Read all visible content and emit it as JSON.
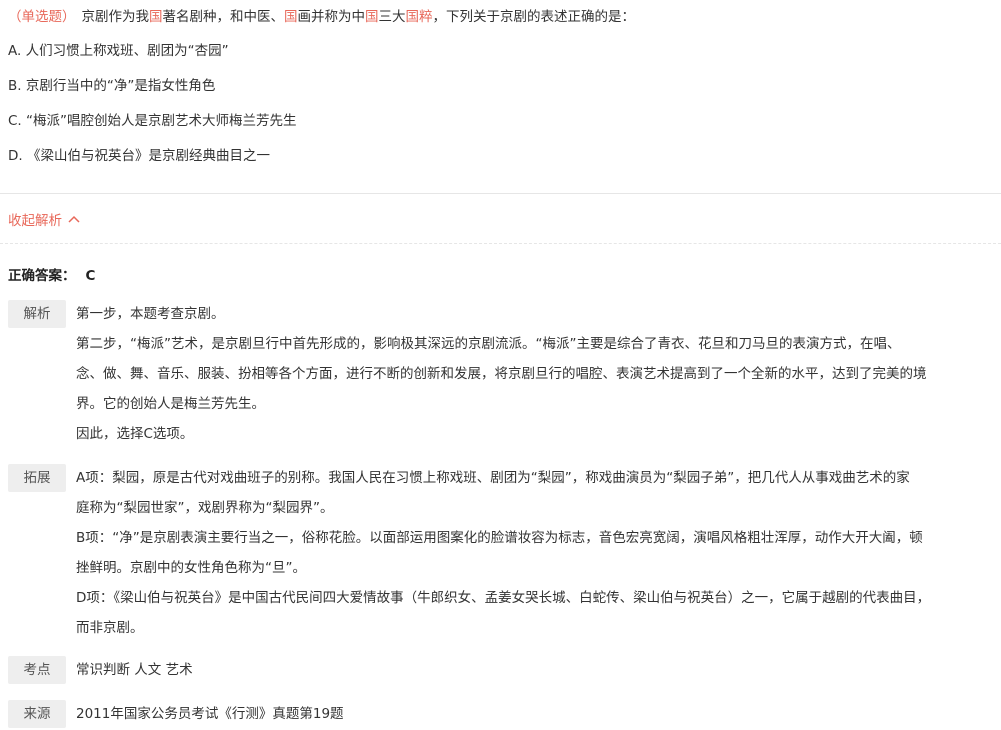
{
  "question": {
    "type_tag": "（单选题）",
    "text_parts": [
      {
        "t": "京剧作为我",
        "hl": false
      },
      {
        "t": "国",
        "hl": true
      },
      {
        "t": "著名剧种，和中医、",
        "hl": false
      },
      {
        "t": "国",
        "hl": true
      },
      {
        "t": "画并称为中",
        "hl": false
      },
      {
        "t": "国",
        "hl": true
      },
      {
        "t": "三大",
        "hl": false
      },
      {
        "t": "国粹",
        "hl": true
      },
      {
        "t": "，下列关于京剧的表述正确的是：",
        "hl": false
      }
    ]
  },
  "options": [
    "A. 人们习惯上称戏班、剧团为“杏园”",
    "B. 京剧行当中的“净”是指女性角色",
    "C. “梅派”唱腔创始人是京剧艺术大师梅兰芳先生",
    "D. 《梁山伯与祝英台》是京剧经典曲目之一"
  ],
  "collapse_label": "收起解析",
  "answer": {
    "label": "正确答案：",
    "value": "C"
  },
  "analysis": {
    "label": "解析",
    "lines": [
      "第一步，本题考查京剧。",
      "第二步，“梅派”艺术，是京剧旦行中首先形成的，影响极其深远的京剧流派。“梅派”主要是综合了青衣、花旦和刀马旦的表演方式，在唱、",
      "念、做、舞、音乐、服装、扮相等各个方面，进行不断的创新和发展，将京剧旦行的唱腔、表演艺术提高到了一个全新的水平，达到了完美的境",
      "界。它的创始人是梅兰芳先生。",
      "因此，选择C选项。"
    ]
  },
  "extension": {
    "label": "拓展",
    "lines": [
      "A项：梨园，原是古代对戏曲班子的别称。我国人民在习惯上称戏班、剧团为“梨园”，称戏曲演员为“梨园子弟”，把几代人从事戏曲艺术的家",
      "庭称为“梨园世家”，戏剧界称为“梨园界”。",
      "B项：“净”是京剧表演主要行当之一，俗称花脸。以面部运用图案化的脸谱妆容为标志，音色宏亮宽阔，演唱风格粗壮浑厚，动作大开大阖，顿",
      "挫鲜明。京剧中的女性角色称为“旦”。",
      "D项：《梁山伯与祝英台》是中国古代民间四大爱情故事（牛郎织女、孟姜女哭长城、白蛇传、梁山伯与祝英台）之一，它属于越剧的代表曲目，",
      "而非京剧。"
    ]
  },
  "knowledge": {
    "label": "考点",
    "value": "常识判断 人文 艺术"
  },
  "source": {
    "label": "来源",
    "value": "2011年国家公务员考试《行测》真题第19题"
  },
  "colors": {
    "accent": "#e8685a",
    "label_bg": "#eeeeee",
    "divider": "#e6e6e6"
  },
  "icons": {
    "collapse": "chevron-up-icon"
  }
}
